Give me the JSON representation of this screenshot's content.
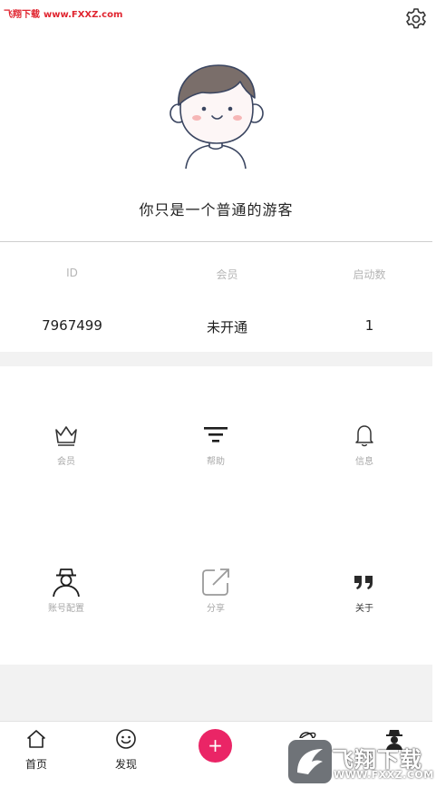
{
  "watermark": {
    "name": "飞翔下载",
    "url": "www.FXXZ.com"
  },
  "profile": {
    "guest_text": "你只是一个普通的游客"
  },
  "stats": [
    {
      "label": "ID",
      "value": "7967499"
    },
    {
      "label": "会员",
      "value": "未开通"
    },
    {
      "label": "启动数",
      "value": "1"
    }
  ],
  "grid": [
    {
      "label": "会员",
      "icon": "crown-icon"
    },
    {
      "label": "帮助",
      "icon": "filter-icon"
    },
    {
      "label": "信息",
      "icon": "bell-icon"
    },
    {
      "label": "账号配置",
      "icon": "user-hat-icon"
    },
    {
      "label": "分享",
      "icon": "share-icon"
    },
    {
      "label": "关于",
      "icon": "quote-icon"
    }
  ],
  "bottom_nav": [
    {
      "label": "首页",
      "icon": "home-icon"
    },
    {
      "label": "发现",
      "icon": "smile-icon"
    },
    {
      "label": "+",
      "icon": "plus-icon"
    },
    {
      "label": "",
      "icon": "planet-icon"
    },
    {
      "label": "",
      "icon": "user-icon"
    }
  ],
  "logo": {
    "title": "飞翔下载",
    "url": "WWW.FXXZ.COM"
  },
  "colors": {
    "accent": "#ea2566",
    "watermark": "#e0242f",
    "label_gray": "#b5b5b5",
    "band": "#f2f2f2"
  }
}
